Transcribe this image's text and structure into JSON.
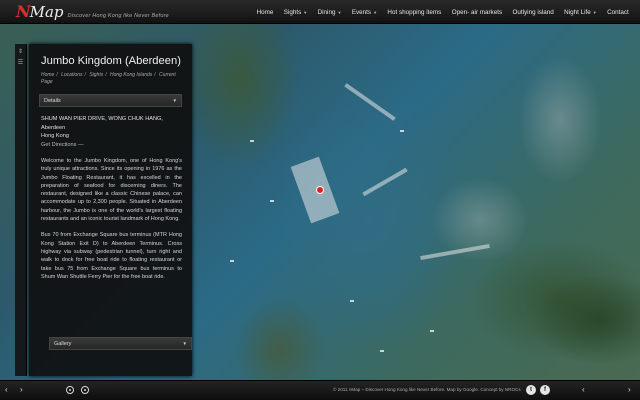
{
  "header": {
    "logo_n": "N",
    "logo_map": "Map",
    "tagline": "Discover Hong Kong like Never Before",
    "nav": [
      {
        "label": "Home",
        "dropdown": false
      },
      {
        "label": "Sights",
        "dropdown": true
      },
      {
        "label": "Dining",
        "dropdown": true
      },
      {
        "label": "Events",
        "dropdown": true
      },
      {
        "label": "Hot shopping items",
        "dropdown": false
      },
      {
        "label": "Open- air markets",
        "dropdown": false
      },
      {
        "label": "Outlying island",
        "dropdown": false
      },
      {
        "label": "Night Life",
        "dropdown": true
      },
      {
        "label": "Contact",
        "dropdown": false
      }
    ]
  },
  "panel": {
    "title": "Jumbo Kingdom (Aberdeen)",
    "breadcrumb": [
      "Home",
      "Locations",
      "Sights",
      "Hong Kong Islands",
      "Current Page"
    ],
    "details_label": "Details",
    "address_lines": [
      "SHUM WAN PIER DRIVE, WONG CHUK HANG,",
      "Aberdeen",
      "Hong Kong"
    ],
    "get_directions": "Get Directions —",
    "paragraph1": "Welcome to the Jumbo Kingdom, one of Hong Kong's truly unique attractions. Since its opening in 1976 as the Jumbo Floating Restaurant, it has excelled in the preparation of seafood for discerning diners. The restaurant, designed like a classic Chinese palace, can accommodate up to 2,300 people. Situated in Aberdeen harbour, the Jumbo is one of the world's largest floating restaurants and an iconic tourist landmark of Hong Kong.",
    "paragraph2": "Bus 70 from Exchange Square bus terminus (MTR Hong Kong Station Exit D) to Aberdeen Terminus. Cross highway via subway (pedestrian tunnel), turn right and walk to dock for free boat ride to floating restaurant or take bus 75 from Exchange Square bus terminus to Shum Wan Shuttle Ferry Pier for the free boat ride.",
    "gallery_label": "Gallery"
  },
  "footer": {
    "copyright": "© 2011 nMap – Discover Hong Kong like Never Before. Map by Google. Concept by NROCs",
    "prev_icon": "‹",
    "next_icon": "›",
    "twitter_letter": "t",
    "facebook_letter": "f"
  },
  "colors": {
    "brand_red": "#d2322d",
    "marker": "#e02020"
  }
}
